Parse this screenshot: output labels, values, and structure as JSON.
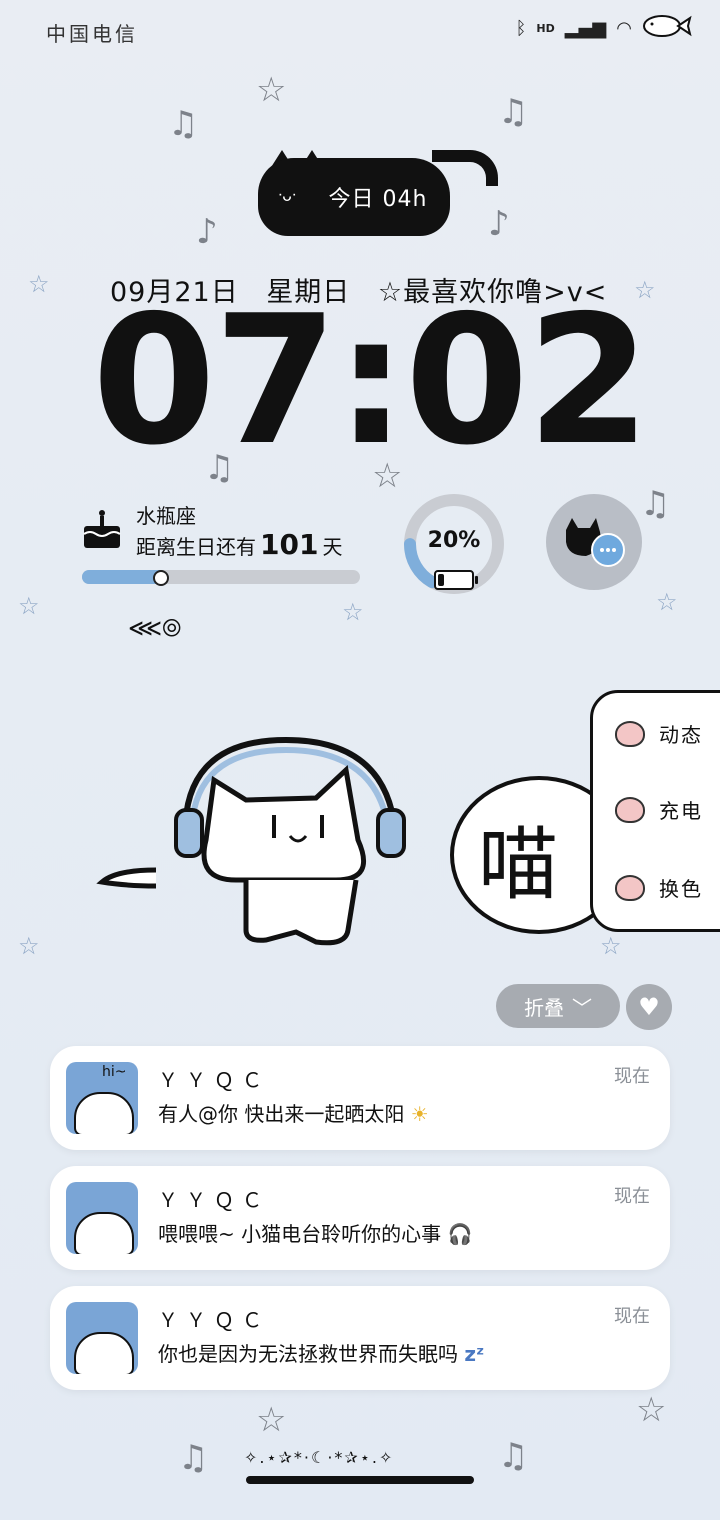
{
  "status_bar": {
    "carrier": "中国电信",
    "icons": [
      "bluetooth-icon",
      "hd-icon",
      "signal-icon",
      "wifi-icon",
      "battery-fish-icon"
    ]
  },
  "timer": {
    "label": "今日 04h"
  },
  "date_line": {
    "date": "09月21日",
    "weekday": "星期日",
    "slogan": "☆最喜欢你噜>v<"
  },
  "clock": {
    "time": "07:02"
  },
  "birthday": {
    "zodiac": "水瓶座",
    "prefix": "距离生日还有",
    "days": "101",
    "suffix": "天",
    "progress": 0.28
  },
  "battery": {
    "percent_label": "20%",
    "level": 0.2
  },
  "mascot": {
    "bubble_text": "喵"
  },
  "side_menu": {
    "items": [
      {
        "label": "动态"
      },
      {
        "label": "充电"
      },
      {
        "label": "换色"
      }
    ]
  },
  "collapse": {
    "label": "折叠"
  },
  "notifications": [
    {
      "avatar_text": "hi~",
      "name": "ＹＹＱＣ",
      "message": "有人@你  快出来一起晒太阳",
      "emoji": "☀",
      "time": "现在"
    },
    {
      "avatar_text": "",
      "name": "ＹＹＱＣ",
      "message": "喂喂喂~ 小猫电台聆听你的心事",
      "emoji": "🎧",
      "time": "现在"
    },
    {
      "avatar_text": "",
      "name": "ＹＹＱＣ",
      "message": "你也是因为无法拯救世界而失眠吗",
      "emoji": "zᶻ",
      "time": "现在"
    }
  ],
  "footer": {
    "decoration": "✧.⋆✰*·☾·*✰⋆.✧"
  },
  "colors": {
    "background": "#e8edf3",
    "progress_fill": "#7faedb",
    "avatar_blue": "#7aa5d6",
    "pill_gray": "#a7abb1"
  }
}
